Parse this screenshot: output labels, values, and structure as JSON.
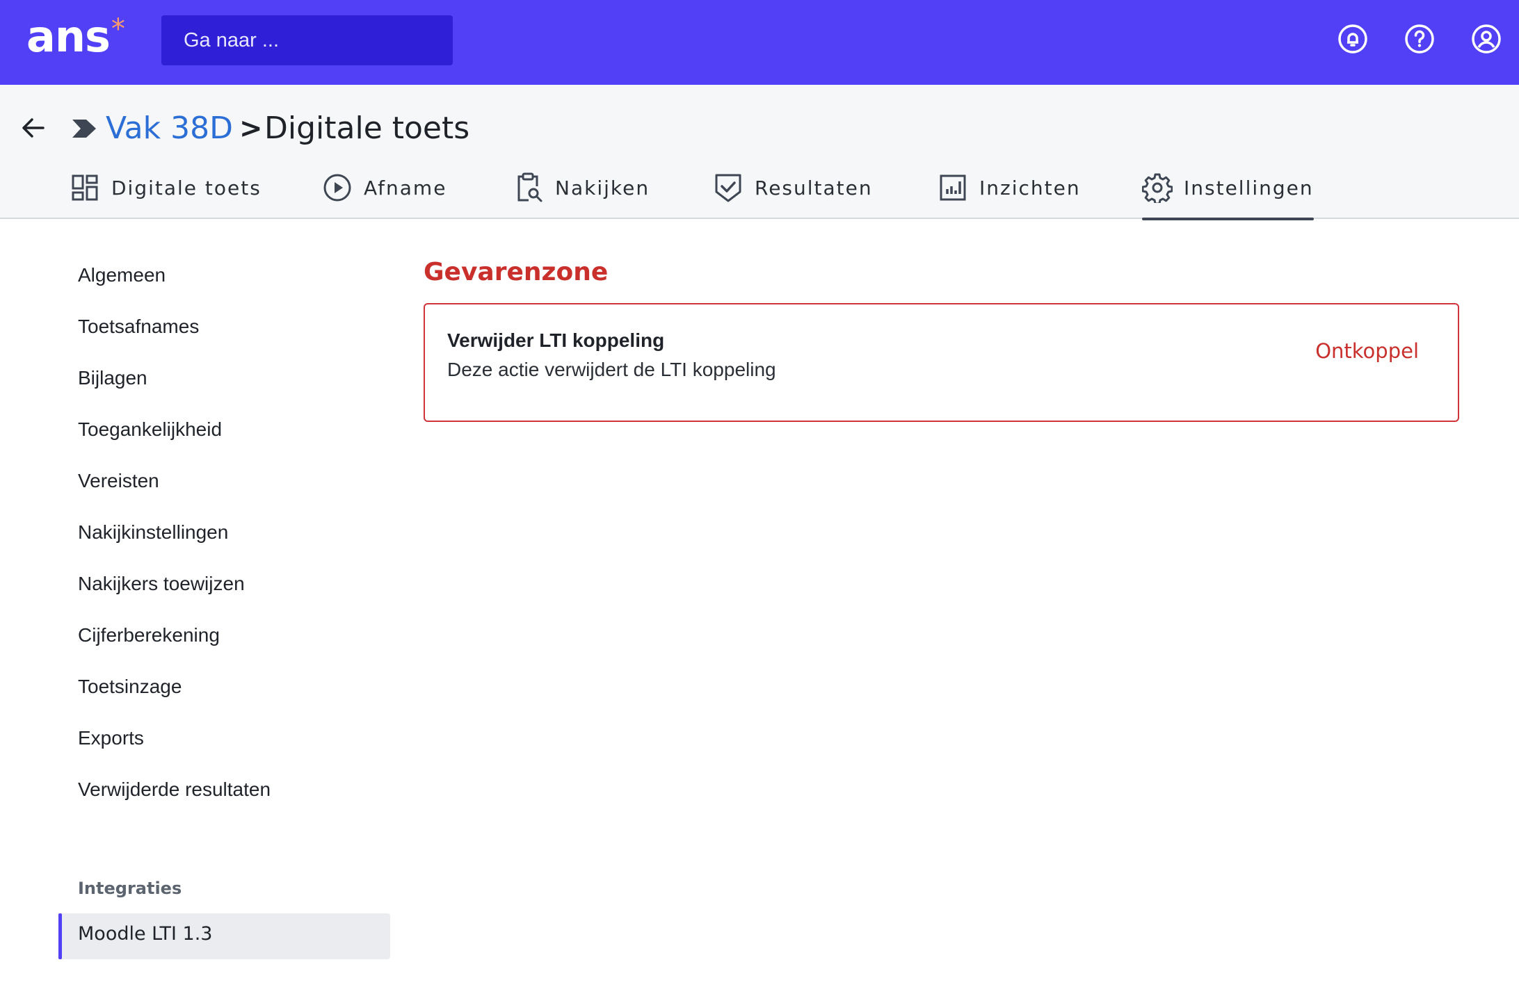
{
  "app": {
    "logo_text": "ans",
    "logo_mark": "*",
    "search_placeholder": "Ga naar ...",
    "top_icons": [
      "bell-icon",
      "help-icon",
      "user-icon"
    ],
    "brand_color": "#5140f5"
  },
  "breadcrumb": {
    "parent": "Vak 38D",
    "separator": ">",
    "current": "Digitale toets"
  },
  "tabs": [
    {
      "label": "Digitale toets",
      "icon": "dashboard-icon"
    },
    {
      "label": "Afname",
      "icon": "play-icon"
    },
    {
      "label": "Nakijken",
      "icon": "clipboard-search-icon"
    },
    {
      "label": "Resultaten",
      "icon": "shield-check-icon"
    },
    {
      "label": "Inzichten",
      "icon": "chart-icon"
    },
    {
      "label": "Instellingen",
      "icon": "gear-icon",
      "active": true
    }
  ],
  "sidebar": {
    "items": [
      "Algemeen",
      "Toetsafnames",
      "Bijlagen",
      "Toegankelijkheid",
      "Vereisten",
      "Nakijkinstellingen",
      "Nakijkers toewijzen",
      "Cijferberekening",
      "Toetsinzage",
      "Exports",
      "Verwijderde resultaten"
    ],
    "section_title": "Integraties",
    "active_item": "Moodle LTI 1.3"
  },
  "main": {
    "title": "Gevarenzone",
    "card": {
      "title": "Verwijder LTI koppeling",
      "description": "Deze actie verwijdert de LTI koppeling",
      "action": "Ontkoppel"
    },
    "danger_color": "#c9302c"
  }
}
